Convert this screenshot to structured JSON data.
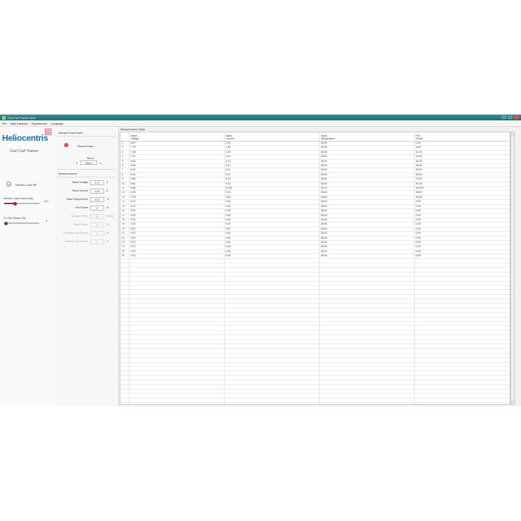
{
  "window": {
    "title": "Fuel Cell Trainer 2013"
  },
  "menu": [
    "File",
    "Main Interface",
    "Experiments",
    "Language"
  ],
  "left_panel": {
    "logo": "Heliocentris",
    "tagline": "Fuel Cell Trainer",
    "toggle_label": "Electric Load Off",
    "load_current": {
      "label": "Electric Load Current (A)",
      "value": "2,5",
      "level": 0.3
    },
    "fan_power": {
      "label": "FC Fan Power (%)",
      "value": "0",
      "level": 0.0
    }
  },
  "experiment": {
    "header": "Manual Experiment",
    "record_label": "Record Data",
    "timer_label": "Timer",
    "timer_value": "139,0",
    "timer_unit_left": "s",
    "timer_unit_right": "s"
  },
  "measurements": {
    "header": "Measurements",
    "rows": [
      {
        "label": "Stack Voltage",
        "value": "9,17",
        "unit": "V"
      },
      {
        "label": "Stack Current",
        "value": "0,04",
        "unit": "A"
      },
      {
        "label": "Stack Temperature",
        "value": "30,2",
        "unit": "°C"
      },
      {
        "label": "Fan Power",
        "value": "0",
        "unit": "%"
      },
      {
        "label": "Hydrogen Flow",
        "value": "19",
        "unit": "ml/min"
      },
      {
        "label": "Stack Power",
        "value": "0",
        "unit": "W"
      },
      {
        "label": "Parasitic Load Power",
        "value": "0",
        "unit": "W"
      },
      {
        "label": "Electric Load Power",
        "value": "0",
        "unit": "W"
      }
    ]
  },
  "table": {
    "title": "Measurement Table",
    "columns": [
      {
        "line1": "Stack",
        "line2": "Voltage"
      },
      {
        "line1": "Stack",
        "line2": "Current"
      },
      {
        "line1": "Stack",
        "line2": "Temperature"
      },
      {
        "line1": "Fan",
        "line2": "Power"
      }
    ],
    "rows": [
      [
        "1",
        "8,87",
        "0,04",
        "28,00",
        "0,00"
      ],
      [
        "2",
        "7,79",
        "1,18",
        "28,00",
        "8,00"
      ],
      [
        "3",
        "7,35",
        "2,15",
        "28,00",
        "14,00"
      ],
      [
        "4",
        "7,07",
        "3,14",
        "28,00",
        "22,00"
      ],
      [
        "5",
        "6,83",
        "4,12",
        "28,00",
        "30,00"
      ],
      [
        "6",
        "6,63",
        "5,12",
        "28,00",
        "38,00"
      ],
      [
        "7",
        "6,49",
        "6,11",
        "28,00",
        "40,00"
      ],
      [
        "8",
        "6,42",
        "6,11",
        "28,00",
        "48,00"
      ],
      [
        "9",
        "5,86",
        "8,10",
        "28,00",
        "73,00"
      ],
      [
        "10",
        "5,81",
        "9,11",
        "28,00",
        "87,00"
      ],
      [
        "11",
        "5,86",
        "10,06",
        "28,10",
        "100,00"
      ],
      [
        "12",
        "6,78",
        "5,12",
        "28,40",
        "38,00"
      ],
      [
        "13",
        "7,39",
        "2,63",
        "28,60",
        "18,00"
      ],
      [
        "14",
        "9,12",
        "0,04",
        "28,00",
        "0,00"
      ],
      [
        "15",
        "9,22",
        "0,04",
        "28,00",
        "0,00"
      ],
      [
        "16",
        "9,22",
        "0,04",
        "28,00",
        "0,00"
      ],
      [
        "17",
        "9,22",
        "0,04",
        "28,00",
        "0,00"
      ],
      [
        "18",
        "9,22",
        "0,04",
        "28,00",
        "0,00"
      ],
      [
        "19",
        "9,22",
        "0,04",
        "28,00",
        "0,00"
      ],
      [
        "20",
        "9,22",
        "0,04",
        "28,00",
        "0,00"
      ],
      [
        "21",
        "9,22",
        "0,04",
        "28,00",
        "0,00"
      ],
      [
        "22",
        "9,22",
        "0,04",
        "28,00",
        "0,00"
      ],
      [
        "23",
        "9,22",
        "0,04",
        "28,00",
        "0,00"
      ],
      [
        "24",
        "9,22",
        "0,04",
        "28,00",
        "0,00"
      ],
      [
        "25",
        "9,22",
        "0,04",
        "28,00",
        "0,00"
      ],
      [
        "26",
        "9,22",
        "0,04",
        "28,00",
        "0,00"
      ]
    ],
    "empty_rows": 34
  },
  "colors": {
    "accent_red": "#c01818",
    "logo_blue": "#1a6f9c",
    "titlebar": "#1b6f73",
    "fan_knob": "#1a4f9c"
  }
}
